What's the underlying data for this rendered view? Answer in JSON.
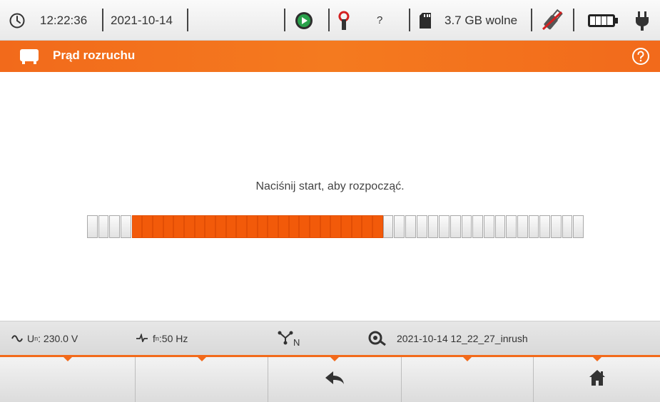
{
  "status_bar": {
    "time": "12:22:36",
    "date": "2021-10-14",
    "unknown_indicator": "?",
    "storage": "3.7 GB wolne",
    "icons": [
      "clock-icon",
      "play-record-icon",
      "clamp-probe-icon",
      "sd-card-icon",
      "usb-disconnected-icon",
      "battery-full-icon",
      "power-plug-icon"
    ]
  },
  "title_bar": {
    "title": "Prąd rozruchu",
    "icons": [
      "device-icon",
      "help-icon"
    ]
  },
  "main": {
    "message": "Naciśnij start, aby rozpocząć.",
    "progress": {
      "segments_total": 46,
      "filled_start": 4,
      "filled_end": 27,
      "fill_color": "#f25a0a"
    }
  },
  "info_bar": {
    "voltage": "U",
    "voltage_sub": "n",
    "voltage_value": ": 230.0 V",
    "freq": "f",
    "freq_sub": "n",
    "freq_value": ":50 Hz",
    "network_sub": "N",
    "file_name": "2021-10-14 12_22_27_inrush"
  },
  "function_keys": [
    {
      "label": "",
      "icon": ""
    },
    {
      "label": "",
      "icon": ""
    },
    {
      "label": "",
      "icon": "back-arrow-icon"
    },
    {
      "label": "",
      "icon": ""
    },
    {
      "label": "",
      "icon": "home-icon"
    }
  ],
  "colors": {
    "accent": "#f26a1b",
    "progress": "#f25a0a"
  }
}
